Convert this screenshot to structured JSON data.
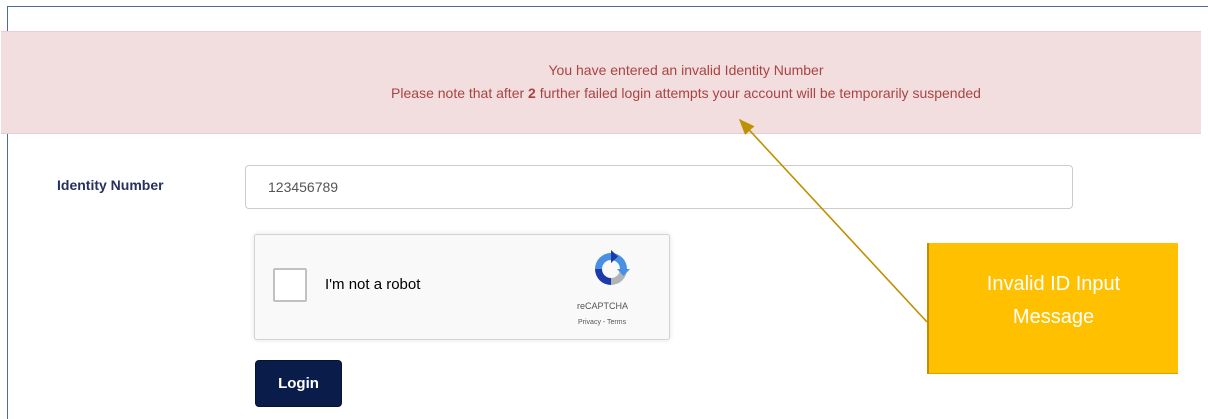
{
  "alert": {
    "line1": "You have entered an invalid Identity Number",
    "line2_prefix": "Please note that after ",
    "line2_count": "2",
    "line2_suffix": " further failed login attempts your account will be temporarily suspended"
  },
  "form": {
    "identity_label": "Identity Number",
    "identity_value": "123456789"
  },
  "captcha": {
    "label": "I'm not a robot",
    "brand": "reCAPTCHA",
    "links": "Privacy - Terms",
    "checked": false
  },
  "login_button": "Login",
  "callout": {
    "line1": "Invalid ID Input",
    "line2": "Message"
  },
  "colors": {
    "alert_bg": "#f2dede",
    "alert_text": "#a94442",
    "login_bg": "#0a1d4a",
    "callout_bg": "#ffc000"
  }
}
